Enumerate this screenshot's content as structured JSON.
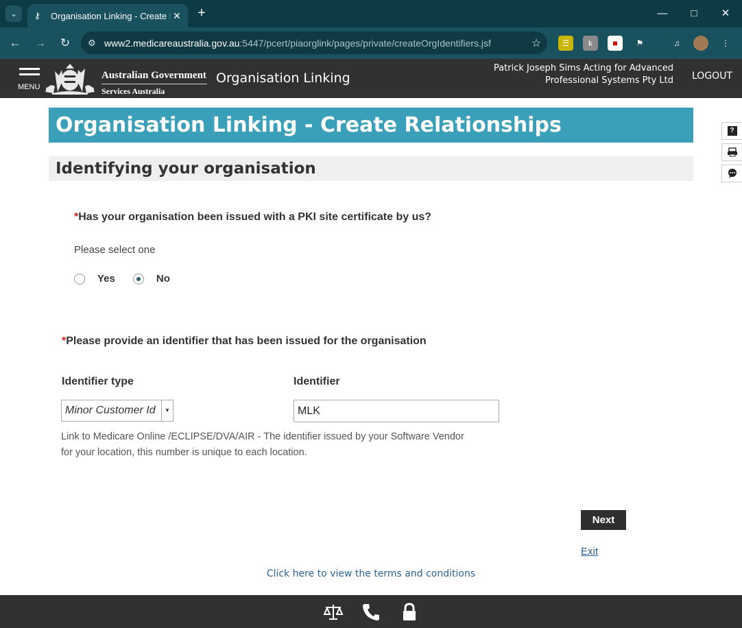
{
  "browser": {
    "tab_title": "Organisation Linking - Create Re",
    "url_host": "www2.medicareaustralia.gov.au",
    "url_rest": ":5447/pcert/piaorglink/pages/private/createOrgIdentifiers.jsf"
  },
  "header": {
    "menu_label": "MENU",
    "gov_title": "Australian Government",
    "gov_subtitle": "Services Australia",
    "app_title": "Organisation Linking",
    "user": "Patrick Joseph Sims Acting for Advanced Professional Systems Pty Ltd",
    "logout": "LOGOUT"
  },
  "page": {
    "title": "Organisation Linking - Create Relationships",
    "section_title": "Identifying your organisation"
  },
  "pki_question": {
    "required_mark": "*",
    "label": "Has your organisation been issued with a PKI site certificate by us?",
    "hint": "Please select one",
    "options": [
      {
        "label": "Yes",
        "selected": false
      },
      {
        "label": "No",
        "selected": true
      }
    ]
  },
  "identifier_question": {
    "required_mark": "*",
    "label": "Please provide an identifier that has been issued for the organisation",
    "type_label": "Identifier type",
    "id_label": "Identifier",
    "type_value": "Minor Customer Id",
    "id_value": "MLK",
    "help_text": "Link to Medicare Online /ECLIPSE/DVA/AIR - The identifier issued by your Software Vendor for your location, this number is unique to each location."
  },
  "actions": {
    "next": "Next",
    "exit": "Exit",
    "terms": "Click here to view the terms and conditions"
  },
  "icons": {
    "side_tools": [
      "help-icon",
      "print-icon",
      "feedback-icon"
    ],
    "footer": [
      "scales-icon",
      "phone-icon",
      "lock-icon"
    ]
  }
}
